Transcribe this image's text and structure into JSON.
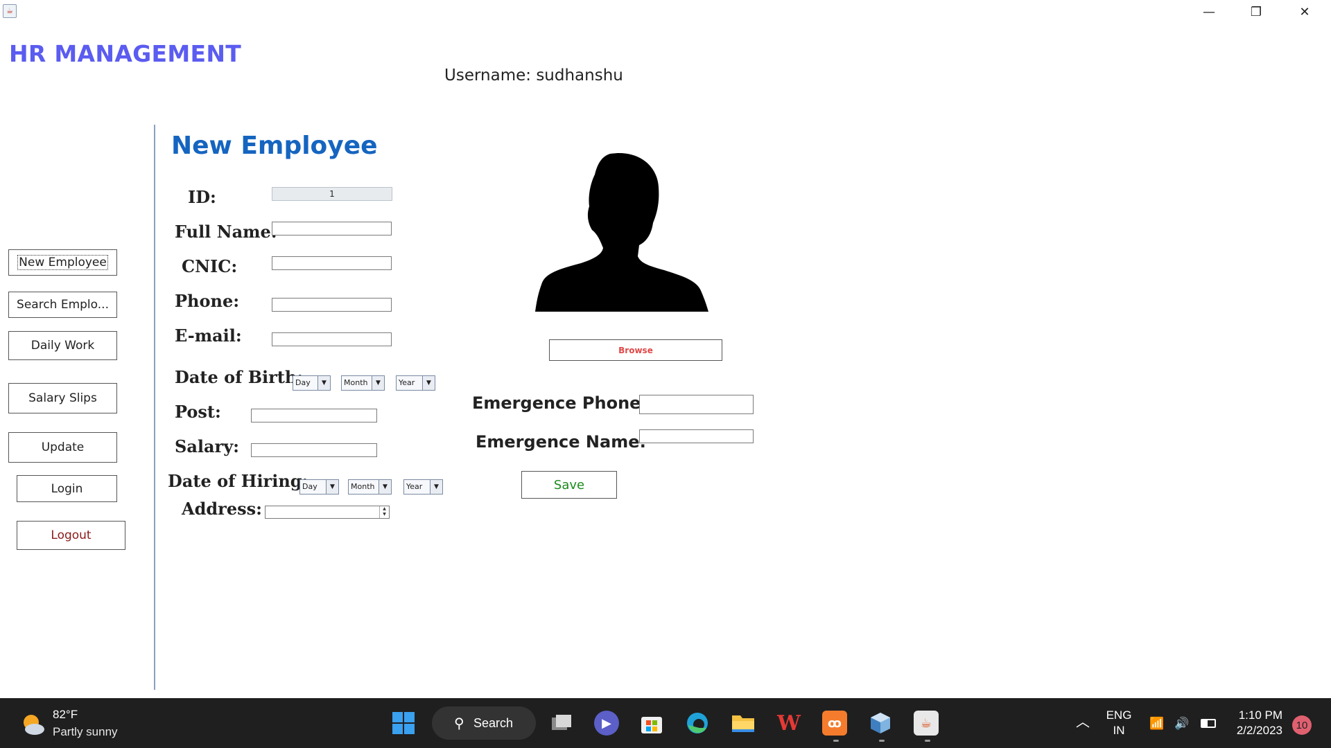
{
  "window": {
    "icon": "java-icon",
    "controls": {
      "minimize": "—",
      "restore": "❐",
      "close": "✕"
    }
  },
  "header": {
    "app_title": "HR MANAGEMENT",
    "username_label": "Username:",
    "username_value": "sudhanshu"
  },
  "sidebar": {
    "items": [
      {
        "label": "New Employee"
      },
      {
        "label": "Search Emplo..."
      },
      {
        "label": "Daily Work"
      },
      {
        "label": "Salary Slips"
      },
      {
        "label": "Update"
      },
      {
        "label": "Login"
      },
      {
        "label": "Logout"
      }
    ]
  },
  "form": {
    "title": "New Employee",
    "id_label": "ID:",
    "id_value": "1",
    "full_name_label": "Full Name:",
    "full_name_value": "",
    "cnic_label": "CNIC:",
    "cnic_value": "",
    "phone_label": "Phone:",
    "phone_value": "",
    "email_label": "E-mail:",
    "email_value": "",
    "dob_label": "Date of Birth:",
    "dob_day": "Day",
    "dob_month": "Month",
    "dob_year": "Year",
    "post_label": "Post:",
    "post_value": "",
    "salary_label": "Salary:",
    "salary_value": "",
    "doh_label": "Date of Hiring:",
    "doh_day": "Day",
    "doh_month": "Month",
    "doh_year": "Year",
    "address_label": "Address:",
    "address_value": "",
    "emergency_phone_label": "Emergence Phone:",
    "emergency_phone_value": "",
    "emergency_name_label": "Emergence Name:",
    "emergency_name_value": "",
    "browse_label": "Browse",
    "save_label": "Save",
    "photo_icon": "person-silhouette-icon"
  },
  "colors": {
    "app_title": "#5b5cf0",
    "section_title": "#1565c0",
    "browse_text": "#e04848",
    "save_text": "#1a8a1a",
    "logout_text": "#8b1a1a",
    "taskbar_bg": "#1f1f1f"
  },
  "taskbar": {
    "weather_temp": "82°F",
    "weather_desc": "Partly sunny",
    "search_label": "Search",
    "apps": [
      "start-icon",
      "task-view-icon",
      "teams-chat-icon",
      "microsoft-store-icon",
      "edge-icon",
      "file-explorer-icon",
      "wps-office-icon",
      "xampp-icon",
      "virtualbox-icon",
      "java-app-icon"
    ],
    "lang_top": "ENG",
    "lang_bottom": "IN",
    "time": "1:10 PM",
    "date": "2/2/2023",
    "notification_count": "10"
  }
}
